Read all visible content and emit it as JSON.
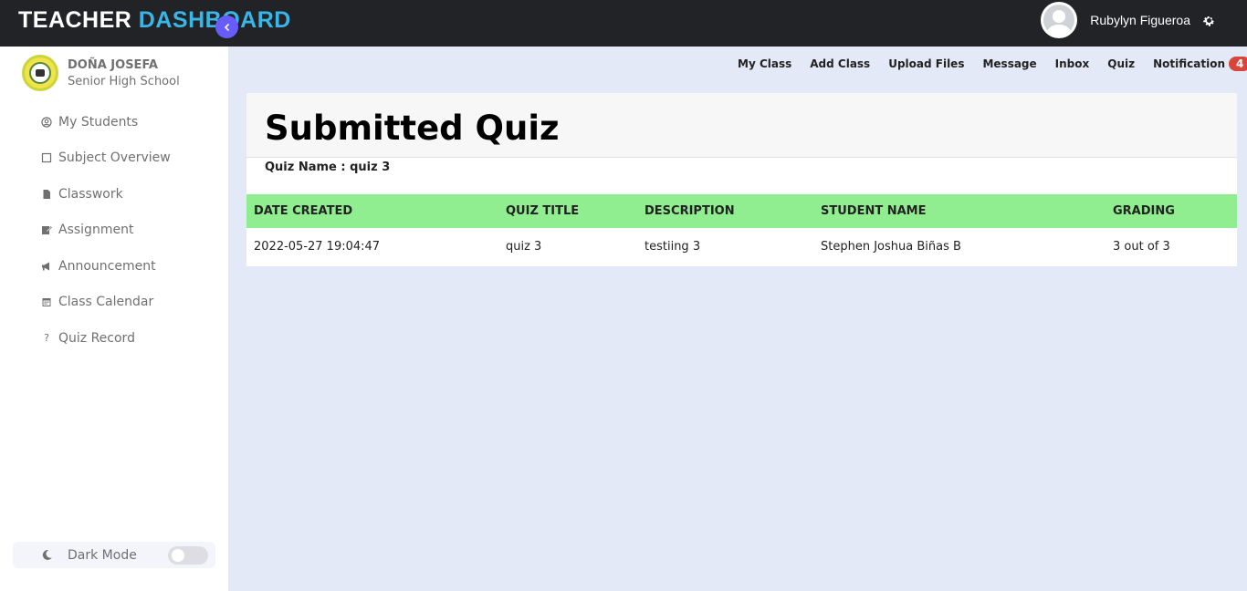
{
  "header": {
    "title_part1": "TEACHER",
    "title_part2": "DASHBOARD",
    "username": "Rubylyn Figueroa"
  },
  "sidebar": {
    "school_line1": "DOÑA JOSEFA",
    "school_line2": "Senior High School",
    "items": [
      {
        "label": "My Students",
        "icon": "user-circle-icon"
      },
      {
        "label": "Subject Overview",
        "icon": "book-icon"
      },
      {
        "label": "Classwork",
        "icon": "file-icon"
      },
      {
        "label": "Assignment",
        "icon": "edit-icon"
      },
      {
        "label": "Announcement",
        "icon": "megaphone-icon"
      },
      {
        "label": "Class Calendar",
        "icon": "calendar-icon"
      },
      {
        "label": "Quiz Record",
        "icon": "question-icon"
      }
    ],
    "dark_mode_label": "Dark Mode"
  },
  "topnav": {
    "links": [
      "My Class",
      "Add Class",
      "Upload Files",
      "Message",
      "Inbox",
      "Quiz",
      "Notification"
    ],
    "notification_count": "4"
  },
  "main": {
    "title": "Submitted Quiz",
    "quiz_name_label": "Quiz Name : quiz 3",
    "table": {
      "headers": [
        "DATE CREATED",
        "QUIZ TITLE",
        "DESCRIPTION",
        "STUDENT NAME",
        "GRADING"
      ],
      "rows": [
        [
          "2022-05-27 19:04:47",
          "quiz 3",
          "testiing 3",
          "Stephen Joshua Biñas B",
          "3 out of 3"
        ]
      ]
    }
  },
  "colors": {
    "accent": "#38b6e8",
    "sidebar_toggle": "#695cfe",
    "table_header": "#90ee90",
    "badge": "#d9443b"
  }
}
